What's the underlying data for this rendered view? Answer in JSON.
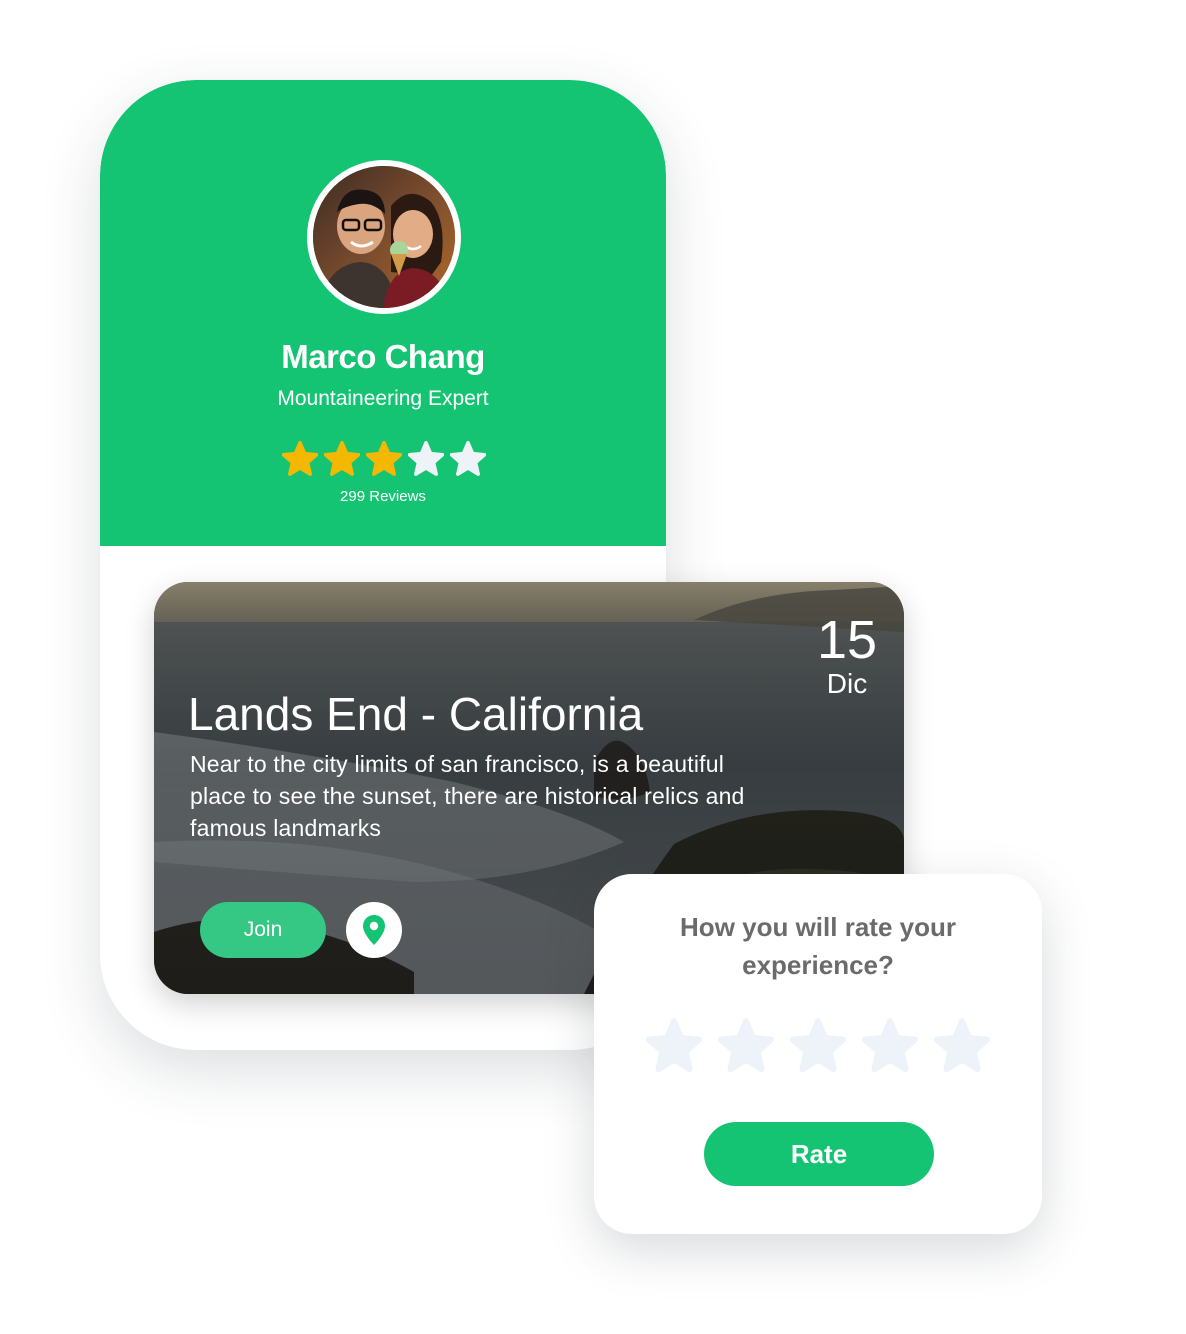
{
  "profile": {
    "name": "Marco Chang",
    "role": "Mountaineering Expert",
    "rating": 3,
    "max_rating": 5,
    "reviews_label": "299 Reviews"
  },
  "event": {
    "day": "15",
    "month": "Dic",
    "title": "Lands End - California",
    "description": "Near to the city limits of san francisco, is a beautiful place to see the sunset, there are historical relics and famous landmarks",
    "join_label": "Join",
    "location_icon": "map-pin-icon"
  },
  "rating_prompt": {
    "question": "How you will rate your experience?",
    "selected_rating": 0,
    "max_rating": 5,
    "button_label": "Rate"
  },
  "colors": {
    "brand_green": "#15c473",
    "join_green": "#35c784",
    "star_filled": "#f5b800",
    "star_empty_on_green": "#eef3f8",
    "star_empty_on_white": "#edf3f8",
    "question_text": "#6b6b6b"
  }
}
